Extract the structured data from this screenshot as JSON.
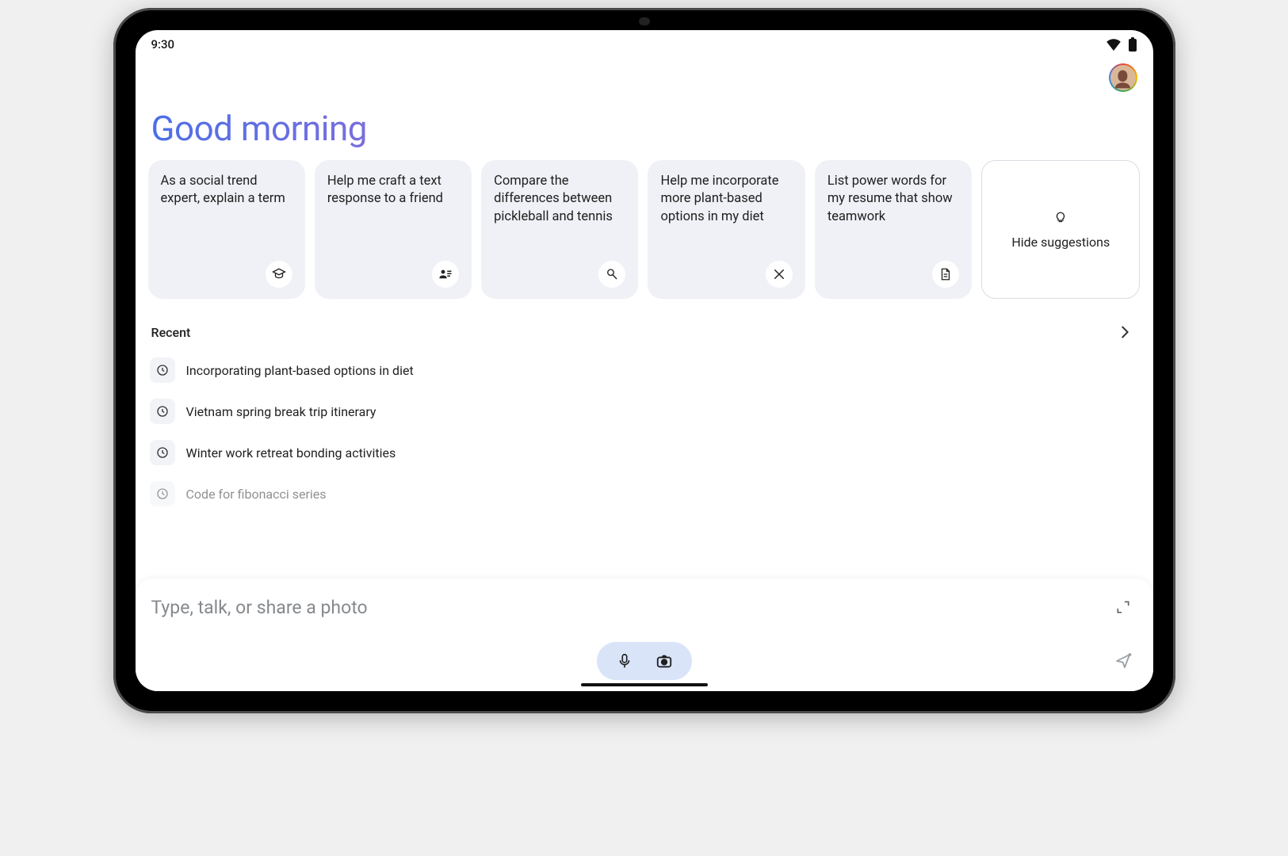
{
  "status": {
    "time": "9:30"
  },
  "greeting": "Good morning",
  "suggestions": [
    {
      "text": "As a social trend expert, explain a term",
      "icon": "education"
    },
    {
      "text": "Help me craft a text response to a friend",
      "icon": "contact"
    },
    {
      "text": "Compare the differences between pickleball and tennis",
      "icon": "sport"
    },
    {
      "text": "Help me incorporate more plant-based options in my diet",
      "icon": "dining"
    },
    {
      "text": "List power words for my resume that show teamwork",
      "icon": "document"
    }
  ],
  "hide_suggestions_label": "Hide suggestions",
  "recent": {
    "title": "Recent",
    "items": [
      "Incorporating plant-based options in diet",
      "Vietnam spring break trip itinerary",
      "Winter work retreat bonding activities",
      "Code for fibonacci series"
    ]
  },
  "composer": {
    "placeholder": "Type, talk, or share a photo"
  }
}
